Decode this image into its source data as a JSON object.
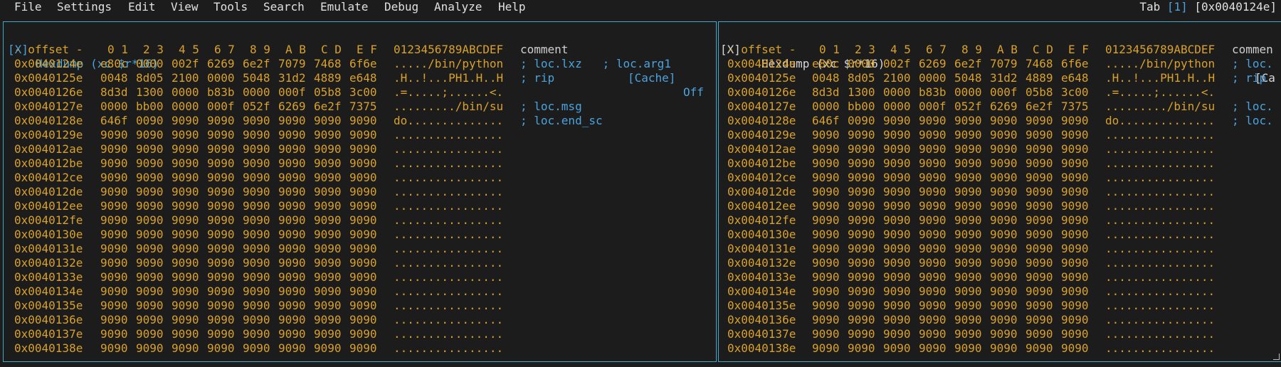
{
  "menu": {
    "items": [
      "File",
      "Settings",
      "Edit",
      "View",
      "Tools",
      "Search",
      "Emulate",
      "Debug",
      "Analyze",
      "Help"
    ],
    "tab_label": "Tab ",
    "tab_number": "[1]",
    "address": " [0x0040124e]"
  },
  "panels": [
    {
      "close": "[X]",
      "title": "Hexdump (xc $r*16)",
      "cache_label": "[Cache]",
      "cache_state": "Off"
    },
    {
      "close": "[X]",
      "title": "Hexdump (xc $r*16)",
      "cache_label": "[Ca",
      "cache_state": ""
    }
  ],
  "hexdump": {
    "header": {
      "offset": "- offset -",
      "cols": [
        "0 1",
        "2 3",
        "4 5",
        "6 7",
        "8 9",
        "A B",
        "C D",
        "E F"
      ],
      "ascii": "0123456789ABCDEF",
      "comment_left": "comment",
      "comment_right": "commen"
    },
    "rows": [
      {
        "addr": "0x0040124e",
        "hex": [
          "e80c",
          "0000",
          "002f",
          "6269",
          "6e2f",
          "7079",
          "7468",
          "6f6e"
        ],
        "ascii": "...../bin/python",
        "comment": "; loc.lxz   ; loc.arg1",
        "comment_r": "; loc."
      },
      {
        "addr": "0x0040125e",
        "hex": [
          "0048",
          "8d05",
          "2100",
          "0000",
          "5048",
          "31d2",
          "4889",
          "e648"
        ],
        "ascii": ".H..!...PH1.H..H",
        "comment": "; rip",
        "comment_r": "; rip"
      },
      {
        "addr": "0x0040126e",
        "hex": [
          "8d3d",
          "1300",
          "0000",
          "b83b",
          "0000",
          "000f",
          "05b8",
          "3c00"
        ],
        "ascii": ".=.....;......<.",
        "comment": "",
        "comment_r": ""
      },
      {
        "addr": "0x0040127e",
        "hex": [
          "0000",
          "bb00",
          "0000",
          "000f",
          "052f",
          "6269",
          "6e2f",
          "7375"
        ],
        "ascii": "........./bin/su",
        "comment": "; loc.msg",
        "comment_r": "; loc."
      },
      {
        "addr": "0x0040128e",
        "hex": [
          "646f",
          "0090",
          "9090",
          "9090",
          "9090",
          "9090",
          "9090",
          "9090"
        ],
        "ascii": "do..............",
        "comment": "; loc.end_sc",
        "comment_r": "; loc."
      },
      {
        "addr": "0x0040129e",
        "hex": [
          "9090",
          "9090",
          "9090",
          "9090",
          "9090",
          "9090",
          "9090",
          "9090"
        ],
        "ascii": "................",
        "comment": "",
        "comment_r": ""
      },
      {
        "addr": "0x004012ae",
        "hex": [
          "9090",
          "9090",
          "9090",
          "9090",
          "9090",
          "9090",
          "9090",
          "9090"
        ],
        "ascii": "................",
        "comment": "",
        "comment_r": ""
      },
      {
        "addr": "0x004012be",
        "hex": [
          "9090",
          "9090",
          "9090",
          "9090",
          "9090",
          "9090",
          "9090",
          "9090"
        ],
        "ascii": "................",
        "comment": "",
        "comment_r": ""
      },
      {
        "addr": "0x004012ce",
        "hex": [
          "9090",
          "9090",
          "9090",
          "9090",
          "9090",
          "9090",
          "9090",
          "9090"
        ],
        "ascii": "................",
        "comment": "",
        "comment_r": ""
      },
      {
        "addr": "0x004012de",
        "hex": [
          "9090",
          "9090",
          "9090",
          "9090",
          "9090",
          "9090",
          "9090",
          "9090"
        ],
        "ascii": "................",
        "comment": "",
        "comment_r": ""
      },
      {
        "addr": "0x004012ee",
        "hex": [
          "9090",
          "9090",
          "9090",
          "9090",
          "9090",
          "9090",
          "9090",
          "9090"
        ],
        "ascii": "................",
        "comment": "",
        "comment_r": ""
      },
      {
        "addr": "0x004012fe",
        "hex": [
          "9090",
          "9090",
          "9090",
          "9090",
          "9090",
          "9090",
          "9090",
          "9090"
        ],
        "ascii": "................",
        "comment": "",
        "comment_r": ""
      },
      {
        "addr": "0x0040130e",
        "hex": [
          "9090",
          "9090",
          "9090",
          "9090",
          "9090",
          "9090",
          "9090",
          "9090"
        ],
        "ascii": "................",
        "comment": "",
        "comment_r": ""
      },
      {
        "addr": "0x0040131e",
        "hex": [
          "9090",
          "9090",
          "9090",
          "9090",
          "9090",
          "9090",
          "9090",
          "9090"
        ],
        "ascii": "................",
        "comment": "",
        "comment_r": ""
      },
      {
        "addr": "0x0040132e",
        "hex": [
          "9090",
          "9090",
          "9090",
          "9090",
          "9090",
          "9090",
          "9090",
          "9090"
        ],
        "ascii": "................",
        "comment": "",
        "comment_r": ""
      },
      {
        "addr": "0x0040133e",
        "hex": [
          "9090",
          "9090",
          "9090",
          "9090",
          "9090",
          "9090",
          "9090",
          "9090"
        ],
        "ascii": "................",
        "comment": "",
        "comment_r": ""
      },
      {
        "addr": "0x0040134e",
        "hex": [
          "9090",
          "9090",
          "9090",
          "9090",
          "9090",
          "9090",
          "9090",
          "9090"
        ],
        "ascii": "................",
        "comment": "",
        "comment_r": ""
      },
      {
        "addr": "0x0040135e",
        "hex": [
          "9090",
          "9090",
          "9090",
          "9090",
          "9090",
          "9090",
          "9090",
          "9090"
        ],
        "ascii": "................",
        "comment": "",
        "comment_r": ""
      },
      {
        "addr": "0x0040136e",
        "hex": [
          "9090",
          "9090",
          "9090",
          "9090",
          "9090",
          "9090",
          "9090",
          "9090"
        ],
        "ascii": "................",
        "comment": "",
        "comment_r": ""
      },
      {
        "addr": "0x0040137e",
        "hex": [
          "9090",
          "9090",
          "9090",
          "9090",
          "9090",
          "9090",
          "9090",
          "9090"
        ],
        "ascii": "................",
        "comment": "",
        "comment_r": ""
      },
      {
        "addr": "0x0040138e",
        "hex": [
          "9090",
          "9090",
          "9090",
          "9090",
          "9090",
          "9090",
          "9090",
          "9090"
        ],
        "ascii": "................",
        "comment": "",
        "comment_r": ""
      }
    ]
  }
}
